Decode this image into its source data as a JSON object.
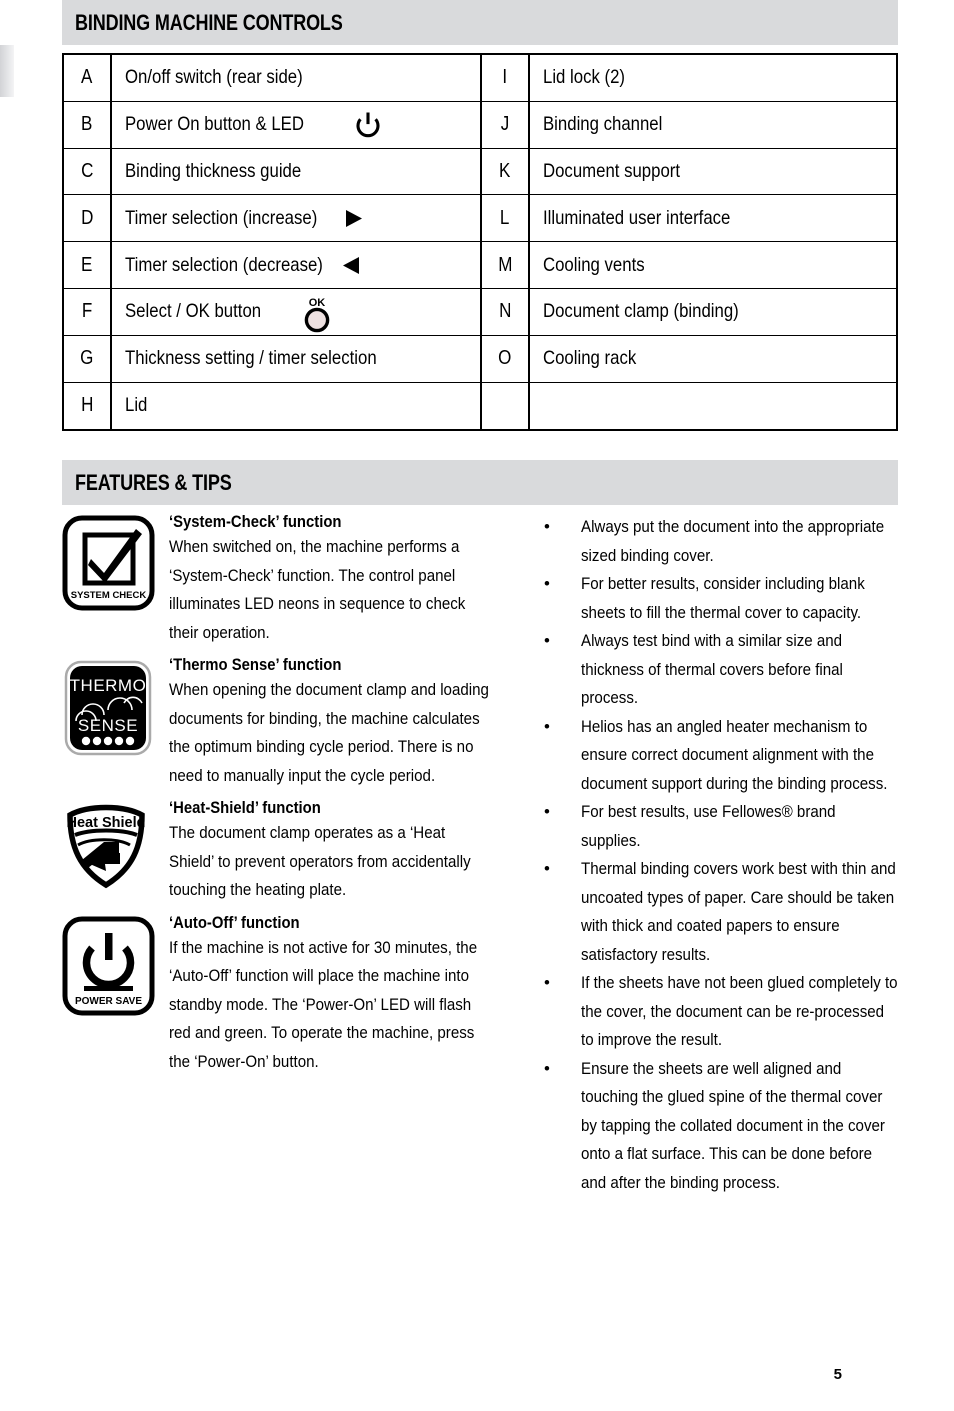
{
  "page": {
    "number": "5"
  },
  "sections": {
    "controls": {
      "title": "BINDING MACHINE CONTROLS",
      "rows_left": [
        {
          "key": "A",
          "label": "On/off switch (rear side)",
          "icon": ""
        },
        {
          "key": "B",
          "label": "Power On button & LED",
          "icon": "power-icon"
        },
        {
          "key": "C",
          "label": "Binding thickness guide",
          "icon": ""
        },
        {
          "key": "D",
          "label": "Timer selection (increase)",
          "icon": "triangle-right-icon"
        },
        {
          "key": "E",
          "label": "Timer selection (decrease)",
          "icon": "triangle-left-icon"
        },
        {
          "key": "F",
          "label": "Select / OK button",
          "icon": "ok-button-icon"
        },
        {
          "key": "G",
          "label": "Thickness setting / timer selection",
          "icon": ""
        },
        {
          "key": "H",
          "label": "Lid",
          "icon": ""
        }
      ],
      "rows_right": [
        {
          "key": "I",
          "label": "Lid lock (2)",
          "icon": ""
        },
        {
          "key": "J",
          "label": "Binding channel",
          "icon": ""
        },
        {
          "key": "K",
          "label": "Document support",
          "icon": ""
        },
        {
          "key": "L",
          "label": "Illuminated user interface",
          "icon": ""
        },
        {
          "key": "M",
          "label": "Cooling vents",
          "icon": ""
        },
        {
          "key": "N",
          "label": "Document clamp (binding)",
          "icon": ""
        },
        {
          "key": "O",
          "label": "Cooling rack",
          "icon": ""
        },
        {
          "key": "",
          "label": "",
          "icon": ""
        }
      ],
      "ok_button_label": "OK"
    },
    "features": {
      "title": "FEATURES & TIPS",
      "items": [
        {
          "icon": "system-check-icon",
          "icon_label": "SYSTEM CHECK",
          "title": "‘System-Check’ function",
          "body": "When switched on, the machine performs a ‘System-Check’ function. The control panel illuminates LED neons in sequence to check their operation."
        },
        {
          "icon": "thermo-sense-icon",
          "icon_label_top": "THERMO",
          "icon_label_bottom": "SENSE",
          "title": "‘Thermo Sense’ function",
          "body": "When opening the document clamp and loading documents for binding, the machine calculates the optimum binding cycle period. There is no need to manually input the cycle period."
        },
        {
          "icon": "heat-shield-icon",
          "icon_label": "Heat Shield",
          "title": "‘Heat-Shield’ function",
          "body": "The document clamp operates as a ‘Heat Shield’ to prevent operators from accidentally touching the heating plate."
        },
        {
          "icon": "power-save-icon",
          "icon_label": "POWER SAVE",
          "title": "‘Auto-Off’ function",
          "body": "If the machine is not active for 30 minutes, the ‘Auto-Off’ function will place the machine into standby mode. The ‘Power-On’ LED will flash red and green. To operate the machine, press the ‘Power-On’ button."
        }
      ],
      "tips": [
        "Always put the document into the appropriate sized binding cover.",
        "For better results, consider including blank sheets to fill the thermal cover to capacity.",
        "Always test bind with a similar size and thickness of thermal covers before final process.",
        "Helios has an angled heater mechanism to ensure correct document alignment with the document support during the binding process.",
        "For best results, use Fellowes® brand supplies.",
        "Thermal binding covers work best with thin and uncoated types of paper. Care should be taken with thick and coated papers to ensure satisfactory results.",
        "If the sheets have not been glued completely to the cover, the document can be re-processed to improve the result.",
        "Ensure the sheets are well aligned and touching the glued spine of the thermal cover by tapping the collated document in the cover onto a flat surface. This can be done before and after the binding process."
      ],
      "bullet_char": "•"
    }
  },
  "colors": {
    "section_bar": "#d9dadc",
    "text": "#000000",
    "ok_button_fill": "#eee1e1"
  }
}
